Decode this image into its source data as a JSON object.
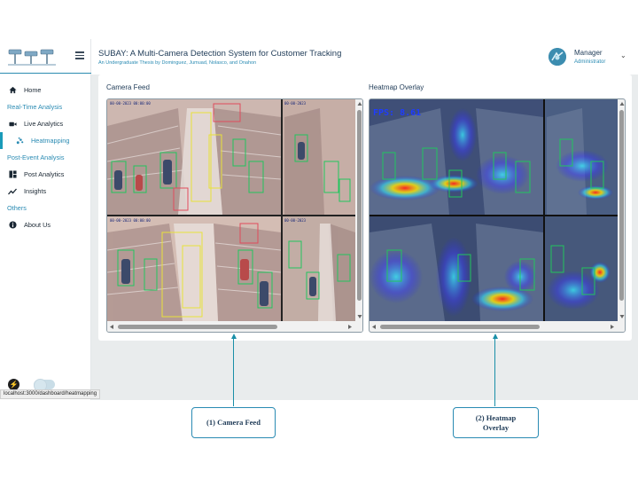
{
  "header": {
    "title": "SUBAY: A Multi-Camera Detection System for Customer Tracking",
    "subtitle": "An Undergraduate Thesis by Dominguez, Jumuad, Nolasco, and Onahon",
    "user_name": "Manager",
    "user_role": "Administrator"
  },
  "sidebar": {
    "items": [
      {
        "type": "item",
        "label": "Home",
        "icon": "home-icon"
      },
      {
        "type": "section",
        "label": "Real-Time Analysis"
      },
      {
        "type": "item",
        "label": "Live Analytics",
        "icon": "video-camera-icon"
      },
      {
        "type": "item",
        "label": "Heatmapping",
        "icon": "scatter-dots-icon",
        "active": true
      },
      {
        "type": "section",
        "label": "Post-Event Analysis"
      },
      {
        "type": "item",
        "label": "Post Analytics",
        "icon": "dashboard-icon"
      },
      {
        "type": "item",
        "label": "Insights",
        "icon": "trend-line-icon"
      },
      {
        "type": "section",
        "label": "Others"
      },
      {
        "type": "item",
        "label": "About Us",
        "icon": "info-icon"
      }
    ]
  },
  "status_bar": {
    "url": "localhost:3000/dashboard/heatmapping"
  },
  "panels": {
    "camera_feed_title": "Camera Feed",
    "heatmap_title": "Heatmap Overlay",
    "fps_label": "FPS: 8.61"
  },
  "annotations": {
    "camera_feed": "(1) Camera Feed",
    "heatmap_line1": "(2) Heatmap",
    "heatmap_line2": "Overlay"
  },
  "colors": {
    "accent": "#2a8bb3",
    "title": "#1f3b57",
    "detection_box": "#22c55e",
    "track_box": "#e8e23a"
  }
}
